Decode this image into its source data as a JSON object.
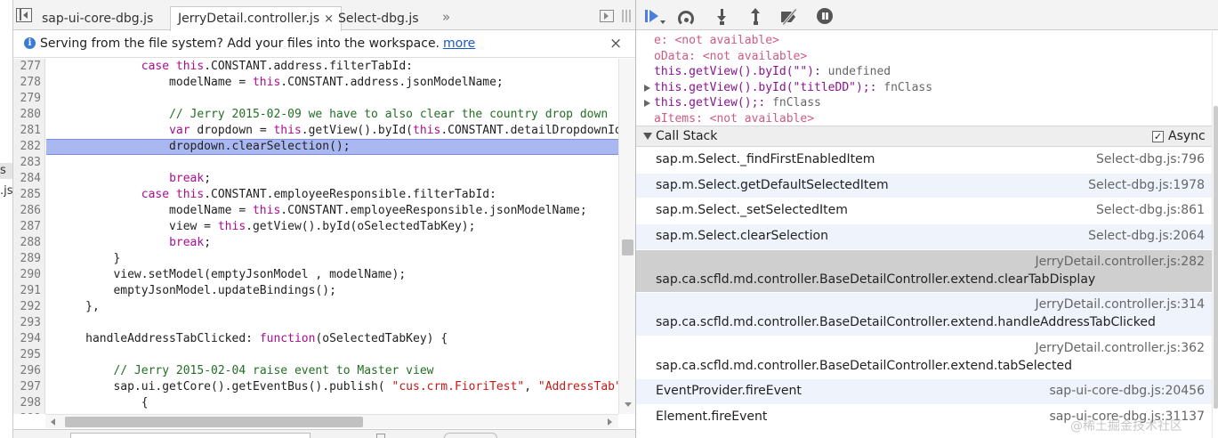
{
  "colors": {
    "current_line_bg": "#aab8f2",
    "keyword": "#aa0d91",
    "string": "#c41a16",
    "comment": "#236e25",
    "selected_frame": "#cfcfcf",
    "alt_frame": "#eef3fc"
  },
  "left_fragment": {
    "item1": "s",
    "item2": ".js"
  },
  "editor": {
    "nav_icon": "navigator-toggle-icon",
    "tabs": [
      {
        "label": "sap-ui-core-dbg.js",
        "active": false
      },
      {
        "label": "JerryDetail.controller.js",
        "active": true,
        "close": "×"
      },
      {
        "label": "Select-dbg.js",
        "active": false
      }
    ],
    "more_tabs": "»",
    "infobar": {
      "icon": "i",
      "message": "Serving from the file system? Add your files into the workspace.",
      "link": "more",
      "close": "×"
    },
    "current_line": 282,
    "lines": [
      {
        "n": "277",
        "t": [
          [
            "             ",
            "p"
          ],
          [
            "case",
            "k"
          ],
          [
            " ",
            "p"
          ],
          [
            "this",
            "k"
          ],
          [
            ".CONSTANT.address.filterTabId:",
            "p"
          ]
        ]
      },
      {
        "n": "278",
        "t": [
          [
            "                 modelName = ",
            "p"
          ],
          [
            "this",
            "k"
          ],
          [
            ".CONSTANT.address.jsonModelName;",
            "p"
          ]
        ]
      },
      {
        "n": "279",
        "t": []
      },
      {
        "n": "280",
        "t": [
          [
            "                 ",
            "p"
          ],
          [
            "// Jerry 2015-02-09 we have to also clear the country drop down",
            "c"
          ]
        ]
      },
      {
        "n": "281",
        "t": [
          [
            "                 ",
            "p"
          ],
          [
            "var",
            "k"
          ],
          [
            " dropdown = ",
            "p"
          ],
          [
            "this",
            "k"
          ],
          [
            ".getView().byId(",
            "p"
          ],
          [
            "this",
            "k"
          ],
          [
            ".CONSTANT.detailDropdownId",
            "p"
          ]
        ]
      },
      {
        "n": "282",
        "t": [
          [
            "                 dropdown.clearSelection();",
            "p"
          ]
        ]
      },
      {
        "n": "283",
        "t": []
      },
      {
        "n": "284",
        "t": [
          [
            "                 ",
            "p"
          ],
          [
            "break",
            "k"
          ],
          [
            ";",
            "p"
          ]
        ]
      },
      {
        "n": "285",
        "t": [
          [
            "             ",
            "p"
          ],
          [
            "case",
            "k"
          ],
          [
            " ",
            "p"
          ],
          [
            "this",
            "k"
          ],
          [
            ".CONSTANT.employeeResponsible.filterTabId:",
            "p"
          ]
        ]
      },
      {
        "n": "286",
        "t": [
          [
            "                 modelName = ",
            "p"
          ],
          [
            "this",
            "k"
          ],
          [
            ".CONSTANT.employeeResponsible.jsonModelName;",
            "p"
          ]
        ]
      },
      {
        "n": "287",
        "t": [
          [
            "                 view = ",
            "p"
          ],
          [
            "this",
            "k"
          ],
          [
            ".getView().byId(oSelectedTabKey);",
            "p"
          ]
        ]
      },
      {
        "n": "288",
        "t": [
          [
            "                 ",
            "p"
          ],
          [
            "break",
            "k"
          ],
          [
            ";",
            "p"
          ]
        ]
      },
      {
        "n": "289",
        "t": [
          [
            "         }",
            "p"
          ]
        ]
      },
      {
        "n": "290",
        "t": [
          [
            "         view.setModel(emptyJsonModel , modelName);",
            "p"
          ]
        ]
      },
      {
        "n": "291",
        "t": [
          [
            "         emptyJsonModel.updateBindings();",
            "p"
          ]
        ]
      },
      {
        "n": "292",
        "t": [
          [
            "     },",
            "p"
          ]
        ]
      },
      {
        "n": "293",
        "t": []
      },
      {
        "n": "294",
        "t": [
          [
            "     handleAddressTabClicked: ",
            "p"
          ],
          [
            "function",
            "k"
          ],
          [
            "(oSelectedTabKey) {",
            "p"
          ]
        ]
      },
      {
        "n": "295",
        "t": []
      },
      {
        "n": "296",
        "t": [
          [
            "         ",
            "p"
          ],
          [
            "// Jerry 2015-02-04 raise event to Master view",
            "c"
          ]
        ]
      },
      {
        "n": "297",
        "t": [
          [
            "         sap.ui.getCore().getEventBus().publish( ",
            "p"
          ],
          [
            "\"cus.crm.FioriTest\"",
            "s"
          ],
          [
            ", ",
            "p"
          ],
          [
            "\"AddressTab\"",
            "s"
          ]
        ]
      },
      {
        "n": "298",
        "t": [
          [
            "             {",
            "p"
          ]
        ]
      },
      {
        "n": "299",
        "t": []
      }
    ]
  },
  "debugger": {
    "toolbar": [
      {
        "id": "tb-resume",
        "icon": "resume-icon"
      },
      {
        "id": "tb-stepover",
        "icon": "step-over-icon"
      },
      {
        "id": "tb-stepinto",
        "icon": "step-into-icon"
      },
      {
        "id": "tb-stepout",
        "icon": "step-out-icon"
      },
      {
        "id": "tb-deactivate",
        "icon": "deactivate-breakpoints-icon"
      },
      {
        "id": "tb-pause",
        "icon": "pause-on-exceptions-icon"
      }
    ],
    "watch": [
      {
        "expr": "e",
        "sep": ": ",
        "value": "<not available>",
        "na": true,
        "arrow": false
      },
      {
        "expr": "oData",
        "sep": ": ",
        "value": "<not available>",
        "na": true,
        "arrow": false
      },
      {
        "expr": "this.getView().byId(\"\")",
        "sep": ": ",
        "value": "undefined",
        "na": false,
        "arrow": false
      },
      {
        "expr": "this.getView().byId(\"titleDD\");",
        "sep": ": ",
        "value": "fnClass",
        "na": false,
        "arrow": true
      },
      {
        "expr": "this.getView();",
        "sep": ": ",
        "value": "fnClass",
        "na": false,
        "arrow": true
      },
      {
        "expr": "aItems",
        "sep": ": ",
        "value": "<not available>",
        "na": true,
        "arrow": false
      }
    ],
    "callstack": {
      "title": "Call Stack",
      "async_label": "Async",
      "async_checked": "✓",
      "frames": [
        {
          "fn": "sap.m.Select._findFirstEnabledItem",
          "loc": "Select-dbg.js:796",
          "style": "plain"
        },
        {
          "fn": "sap.m.Select.getDefaultSelectedItem",
          "loc": "Select-dbg.js:1978",
          "style": "alt"
        },
        {
          "fn": "sap.m.Select._setSelectedItem",
          "loc": "Select-dbg.js:861",
          "style": "plain"
        },
        {
          "fn": "sap.m.Select.clearSelection",
          "loc": "Select-dbg.js:2064",
          "style": "alt"
        },
        {
          "fn": "sap.ca.scfld.md.controller.BaseDetailController.extend.clearTabDisplay",
          "loc": "JerryDetail.controller.js:282",
          "style": "selected"
        },
        {
          "fn": "sap.ca.scfld.md.controller.BaseDetailController.extend.handleAddressTabClicked",
          "loc": "JerryDetail.controller.js:314",
          "style": "alt"
        },
        {
          "fn": "sap.ca.scfld.md.controller.BaseDetailController.extend.tabSelected",
          "loc": "JerryDetail.controller.js:362",
          "style": "plain"
        },
        {
          "fn": "EventProvider.fireEvent",
          "loc": "sap-ui-core-dbg.js:20456",
          "style": "alt"
        },
        {
          "fn": "Element.fireEvent",
          "loc": "sap-ui-core-dbg.js:31137",
          "style": "plain"
        }
      ]
    }
  },
  "watermark": "@稀土掘金技术社区"
}
